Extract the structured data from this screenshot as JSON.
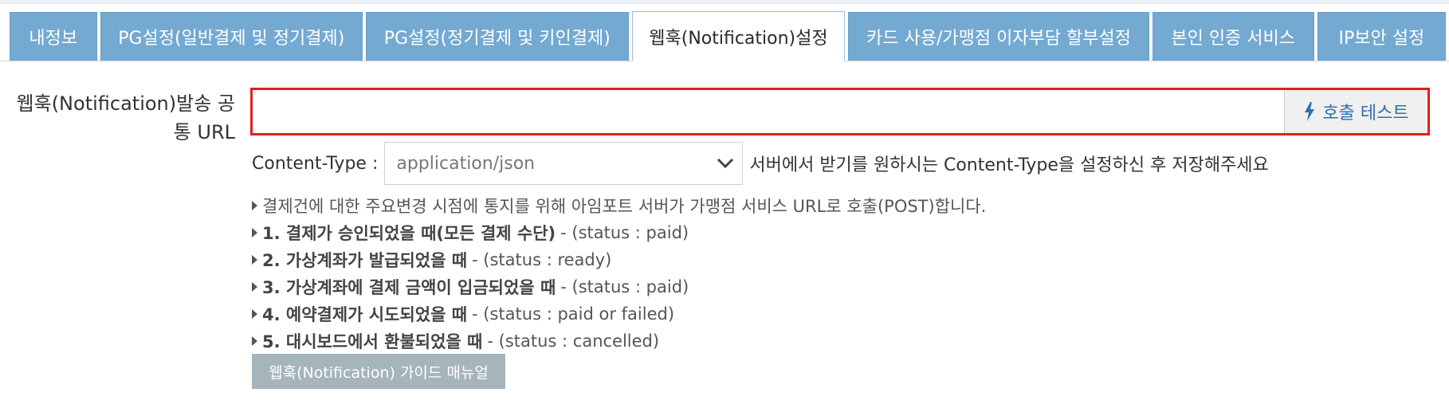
{
  "tabs": [
    {
      "label": "내정보",
      "active": false
    },
    {
      "label": "PG설정(일반결제 및 정기결제)",
      "active": false
    },
    {
      "label": "PG설정(정기결제 및 키인결제)",
      "active": false
    },
    {
      "label": "웹훅(Notification)설정",
      "active": true
    },
    {
      "label": "카드 사용/가맹점 이자부담 할부설정",
      "active": false
    },
    {
      "label": "본인 인증 서비스",
      "active": false
    },
    {
      "label": "IP보안 설정",
      "active": false
    }
  ],
  "webhook": {
    "url_label": "웹훅(Notification)발송 공통 URL",
    "url_value": "",
    "test_button_label": "호출 테스트",
    "test_button_icon": "bolt-icon",
    "content_type_label": "Content-Type :",
    "content_type_selected": "application/json",
    "content_type_hint": "서버에서 받기를 원하시는 Content-Type을 설정하신 후 저장해주세요"
  },
  "notes": {
    "intro": "결제건에 대한 주요변경 시점에 통지를 위해 아임포트 서버가 가맹점 서비스 URL로 호출(POST)합니다.",
    "items": [
      {
        "title": "1. 결제가 승인되었을 때(모든 결제 수단)",
        "status": "- (status : paid)"
      },
      {
        "title": "2. 가상계좌가 발급되었을 때",
        "status": "- (status : ready)"
      },
      {
        "title": "3. 가상계좌에 결제 금액이 입금되었을 때",
        "status": "- (status : paid)"
      },
      {
        "title": "4. 예약결제가 시도되었을 때",
        "status": "- (status : paid or failed)"
      },
      {
        "title": "5. 대시보드에서 환불되었을 때",
        "status": "- (status : cancelled)"
      }
    ]
  },
  "guide_button_label": "웹훅(Notification) 가이드 매뉴얼",
  "colors": {
    "tab_bg": "#74a9d1",
    "highlight_border": "#e0201b",
    "link_blue": "#2f6fb0",
    "guide_button_bg": "#a6b4bb"
  }
}
